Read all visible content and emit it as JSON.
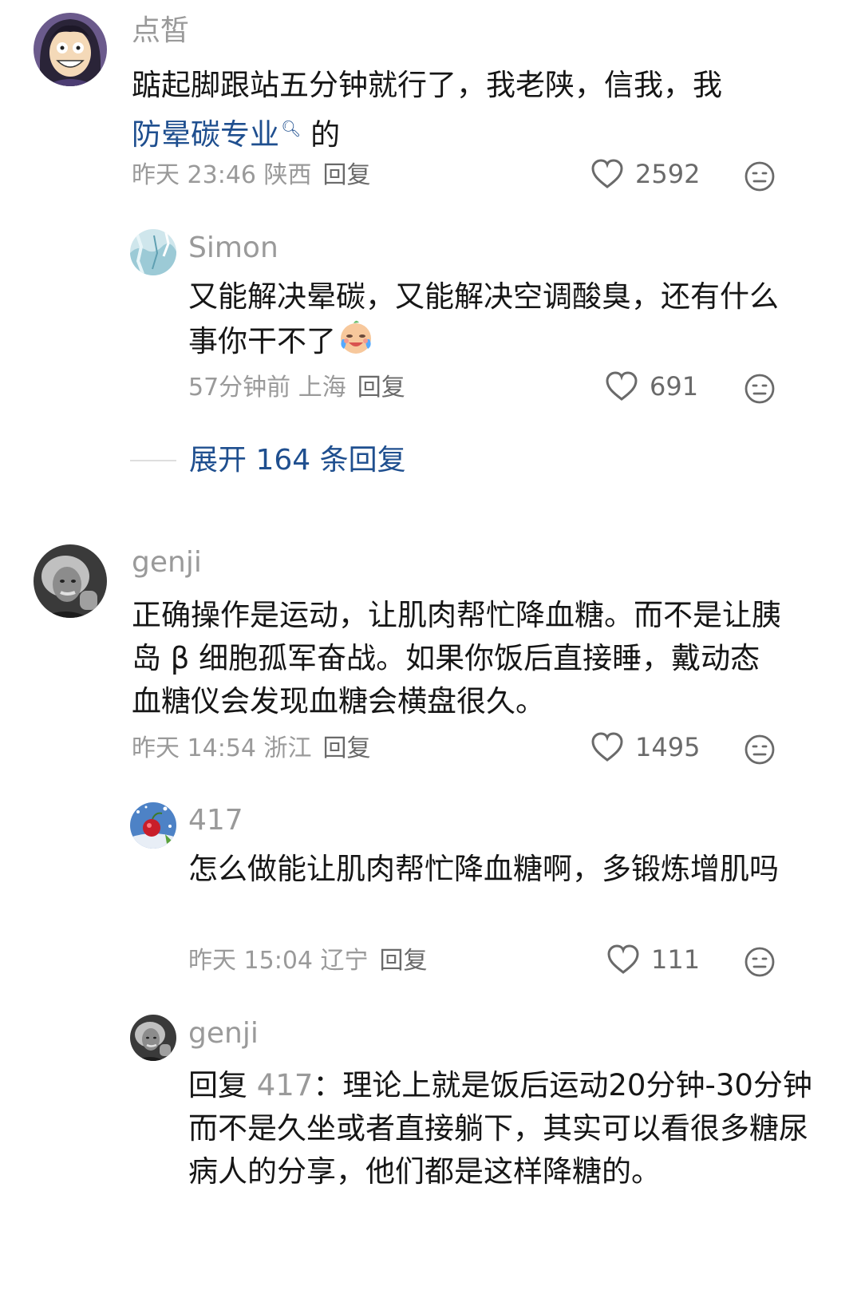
{
  "comments": [
    {
      "username": "点皙",
      "text_before": "踮起脚跟站五分钟就行了，我老陕，信我，我",
      "keyword": "防晕碳专业",
      "keyword_icon": "search-icon",
      "text_after": " 的",
      "time": "昨天 23:46 陕西",
      "reply": "回复",
      "likes": "2592",
      "avatar": "cartoon-avatar"
    },
    {
      "username": "Simon",
      "text": "又能解决晕碳，又能解决空调酸臭，还有什么事你干不了",
      "emoji": "crying-laugh-emoji",
      "time": "57分钟前 上海",
      "reply": "回复",
      "likes": "691",
      "avatar": "ice-texture-avatar"
    },
    {
      "username": "genji",
      "text": "正确操作是运动，让肌肉帮忙降血糖。而不是让胰岛 β 细胞孤军奋战。如果你饭后直接睡，戴动态血糖仪会发现血糖会横盘很久。",
      "time": "昨天 14:54 浙江",
      "reply": "回复",
      "likes": "1495",
      "avatar": "einstein-avatar"
    },
    {
      "username": "417",
      "text": "怎么做能让肌肉帮忙降血糖啊，多锻炼增肌吗",
      "time": "昨天 15:04 辽宁",
      "reply": "回复",
      "likes": "111",
      "avatar": "cherry-avatar"
    },
    {
      "username": "genji",
      "reply_prefix": "回复",
      "reply_target": "417",
      "text": "：理论上就是饭后运动20分钟-30分钟而不是久坐或者直接躺下，其实可以看很多糖尿病人的分享，他们都是这样降糖的。",
      "avatar": "einstein-avatar"
    }
  ],
  "expand_replies": "展开 164 条回复",
  "colors": {
    "link": "#1f4f8f",
    "meta": "#9a9a9a",
    "text": "#161616"
  }
}
